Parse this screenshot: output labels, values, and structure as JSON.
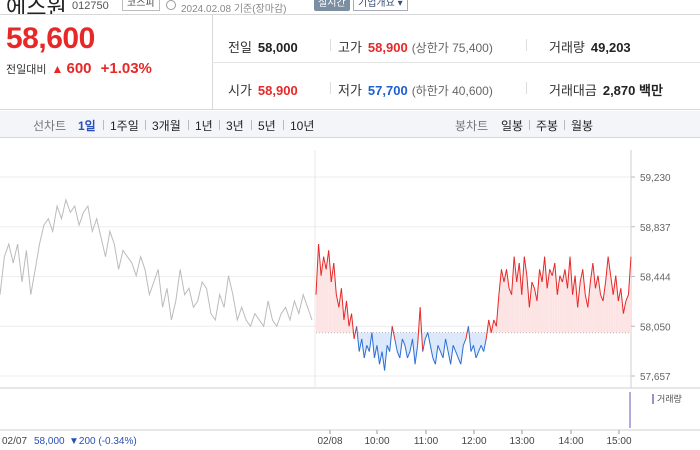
{
  "header": {
    "name": "에스원",
    "code": "012750",
    "market": "코스피",
    "date_text": "2024.02.08  기준(장마감)",
    "realtime": "실시간",
    "company_info": "기업개요 ▾"
  },
  "price": {
    "current": "58,600",
    "change_label": "전일대비",
    "change_arrow": "▲",
    "change_value": "600",
    "change_pct": "+1.03%"
  },
  "stats": {
    "prev_close_label": "전일",
    "prev_close": "58,000",
    "high_label": "고가",
    "high": "58,900",
    "upper_limit": "(상한가 75,400)",
    "volume_label": "거래량",
    "volume": "49,203",
    "open_label": "시가",
    "open": "58,900",
    "low_label": "저가",
    "low": "57,700",
    "lower_limit": "(하한가 40,600)",
    "amount_label": "거래대금",
    "amount": "2,870 백만"
  },
  "tabs": {
    "line_label": "선차트",
    "line_tabs": [
      "1일",
      "1주일",
      "3개월",
      "1년",
      "3년",
      "5년",
      "10년"
    ],
    "active": "1일",
    "candle_label": "봉차트",
    "candle_tabs": [
      "일봉",
      "주봉",
      "월봉"
    ]
  },
  "chart_data": {
    "type": "line",
    "y_ticks": [
      "59,230",
      "58,837",
      "58,444",
      "58,050",
      "57,657"
    ],
    "ylim": [
      57657,
      59230
    ],
    "baseline": 58000,
    "x_ticks": [
      "02/08",
      "10:00",
      "11:00",
      "12:00",
      "13:00",
      "14:00",
      "15:00"
    ],
    "prev_day_label": "02/07",
    "prev_day_close": "58,000",
    "prev_day_change": "▼200 (-0.34%)",
    "volume_label": "거래량",
    "colors": {
      "up": "#e62828",
      "down": "#2a6fd6",
      "prev": "#bbbbbb",
      "up_fill": "#fde4e4",
      "down_fill": "#dbe7fb"
    },
    "prev_day_series": [
      58300,
      58600,
      58700,
      58550,
      58700,
      58400,
      58650,
      58300,
      58500,
      58700,
      58850,
      58900,
      58800,
      59000,
      58900,
      59050,
      58950,
      59000,
      58850,
      58950,
      59000,
      58800,
      58900,
      58750,
      58600,
      58800,
      58700,
      58500,
      58650,
      58600,
      58550,
      58450,
      58600,
      58500,
      58300,
      58400,
      58500,
      58200,
      58350,
      58100,
      58250,
      58500,
      58300,
      58350,
      58200,
      58250,
      58400,
      58350,
      58150,
      58100,
      58300,
      58200,
      58450,
      58300,
      58100,
      58200,
      58100,
      58050,
      58150,
      58100,
      58050,
      58250,
      58100,
      58050,
      58150,
      58200,
      58100,
      58250,
      58150,
      58300,
      58200,
      58100
    ],
    "today_series": [
      58300,
      58700,
      58450,
      58600,
      58500,
      58650,
      58400,
      58550,
      58300,
      58200,
      58350,
      58100,
      58250,
      58050,
      58150,
      57950,
      58050,
      57850,
      57950,
      57800,
      57900,
      57850,
      58000,
      57800,
      57900,
      57750,
      57850,
      57700,
      57900,
      57850,
      58050,
      57950,
      57850,
      57800,
      57950,
      57900,
      57800,
      57850,
      57950,
      57750,
      57900,
      58200,
      57850,
      57950,
      58000,
      57900,
      57800,
      57750,
      57900,
      57850,
      57800,
      57950,
      57850,
      57750,
      57900,
      57850,
      57800,
      57750,
      57900,
      57950,
      58050,
      57850,
      57900,
      57800,
      57850,
      57900,
      57850,
      57950,
      58100,
      58000,
      58100,
      58050,
      58300,
      58500,
      58400,
      58500,
      58350,
      58300,
      58600,
      58400,
      58550,
      58300,
      58600,
      58450,
      58200,
      58400,
      58350,
      58250,
      58500,
      58400,
      58600,
      58350,
      58500,
      58450,
      58550,
      58300,
      58450,
      58400,
      58500,
      58350,
      58600,
      58300,
      58450,
      58200,
      58400,
      58500,
      58300,
      58200,
      58400,
      58550,
      58350,
      58450,
      58300,
      58250,
      58400,
      58600,
      58450,
      58300,
      58450,
      58250,
      58350,
      58150,
      58250,
      58300,
      58600
    ]
  }
}
